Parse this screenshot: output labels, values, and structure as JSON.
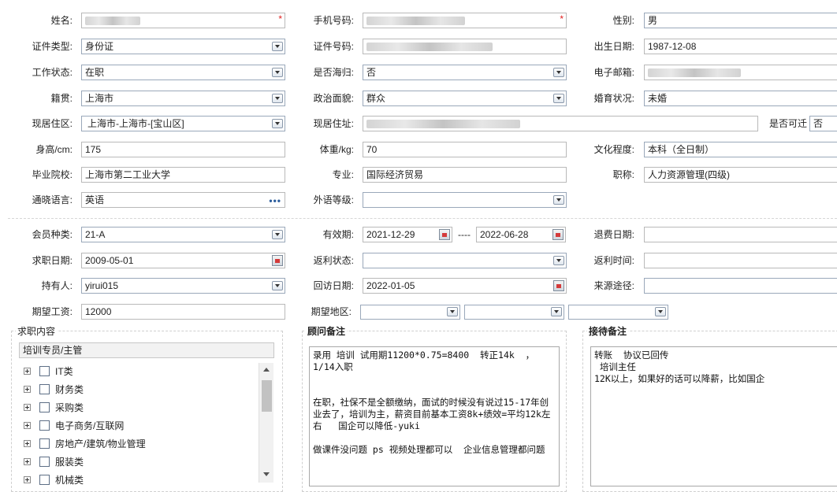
{
  "fields": {
    "name": {
      "label": "姓名:",
      "required": "*"
    },
    "mobile": {
      "label": "手机号码:",
      "required": "*"
    },
    "gender": {
      "label": "性别:",
      "value": "男"
    },
    "id_type": {
      "label": "证件类型:",
      "value": "身份证"
    },
    "id_number": {
      "label": "证件号码:"
    },
    "birth_date": {
      "label": "出生日期:",
      "value": "1987-12-08"
    },
    "work_status": {
      "label": "工作状态:",
      "value": "在职"
    },
    "returnee": {
      "label": "是否海归:",
      "value": "否"
    },
    "email": {
      "label": "电子邮箱:"
    },
    "native_place": {
      "label": "籍贯:",
      "value": "上海市"
    },
    "political": {
      "label": "政治面貌:",
      "value": "群众"
    },
    "marital": {
      "label": "婚育状况:",
      "value": "未婚"
    },
    "residence_area": {
      "label": "现居住区:",
      "value": "上海市-上海市-[宝山区]"
    },
    "residence_address": {
      "label": "现居住址:"
    },
    "relocatable": {
      "label": "是否可迁",
      "value": "否"
    },
    "height": {
      "label": "身高/cm:",
      "value": "175"
    },
    "weight": {
      "label": "体重/kg:",
      "value": "70"
    },
    "education": {
      "label": "文化程度:",
      "value": "本科（全日制）"
    },
    "school": {
      "label": "毕业院校:",
      "value": "上海市第二工业大学"
    },
    "major": {
      "label": "专业:",
      "value": "国际经济贸易"
    },
    "title": {
      "label": "职称:",
      "value": "人力资源管理(四级)"
    },
    "language": {
      "label": "通晓语言:",
      "value": "英语"
    },
    "language_level": {
      "label": "外语等级:",
      "value": ""
    },
    "member_type": {
      "label": "会员种类:",
      "value": "21-A"
    },
    "validity": {
      "label": "有效期:",
      "from": "2021-12-29",
      "sep": "----",
      "to": "2022-06-28"
    },
    "refund_date": {
      "label": "退费日期:",
      "value": ""
    },
    "job_seek_date": {
      "label": "求职日期:",
      "value": "2009-05-01"
    },
    "rebate_status": {
      "label": "返利状态:",
      "value": ""
    },
    "rebate_time": {
      "label": "返利时间:",
      "value": ""
    },
    "holder": {
      "label": "持有人:",
      "value": "yirui015"
    },
    "revisit_date": {
      "label": "回访日期:",
      "value": "2022-01-05"
    },
    "source": {
      "label": "来源途径:",
      "value": ""
    },
    "expected_salary": {
      "label": "期望工资:",
      "value": "12000"
    },
    "expected_region": {
      "label": "期望地区:",
      "value": ""
    }
  },
  "job_content": {
    "title": "求职内容",
    "selected": "培训专员/主管",
    "tree": [
      "IT类",
      "财务类",
      "采购类",
      "电子商务/互联网",
      "房地产/建筑/物业管理",
      "服装类",
      "机械类"
    ]
  },
  "consultant_notes": {
    "title": "顾问备注",
    "text": "录用 培训 试用期11200*0.75=8400  转正14k  ， 1/14入职\n\n\n在职，社保不是全额缴纳，面试的时候没有说过15-17年创业去了，培训为主，薪资目前基本工资8k+绩效=平均12k左右   国企可以降低-yuki\n\n做课件没问题 ps 视频处理都可以  企业信息管理都问题"
  },
  "reception_notes": {
    "title": "接待备注",
    "text": "转账  协议已回传\n 培训主任\n12K以上，如果好的话可以降薪，比如国企"
  }
}
